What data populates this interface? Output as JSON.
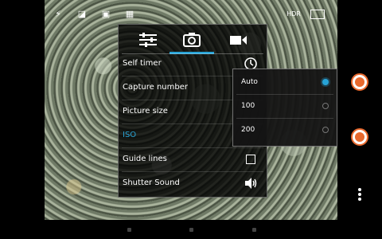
{
  "settings_panel": {
    "tabs": [
      {
        "name": "settings-tab",
        "icon": "sliders-icon"
      },
      {
        "name": "photo-tab",
        "icon": "camera-icon",
        "active": true
      },
      {
        "name": "video-tab",
        "icon": "video-camera-icon"
      }
    ],
    "rows": [
      {
        "label": "Self timer",
        "control": "timer-icon"
      },
      {
        "label": "Capture number"
      },
      {
        "label": "Picture size"
      },
      {
        "label": "ISO",
        "active": true
      },
      {
        "label": "Guide lines",
        "control": "checkbox"
      },
      {
        "label": "Shutter Sound",
        "control": "speaker-icon"
      }
    ]
  },
  "iso_dropdown": {
    "options": [
      {
        "label": "Auto",
        "selected": true
      },
      {
        "label": "100",
        "selected": false
      },
      {
        "label": "200",
        "selected": false
      }
    ]
  },
  "colors": {
    "accent": "#27a3d6",
    "shutter": "#e8692e"
  },
  "icons": [
    "flash-icon",
    "exposure-icon",
    "scene-icon",
    "grid-icon",
    "hdr-icon",
    "camera-switch-icon",
    "camera-shutter-icon",
    "video-record-icon",
    "overflow-menu-icon"
  ]
}
